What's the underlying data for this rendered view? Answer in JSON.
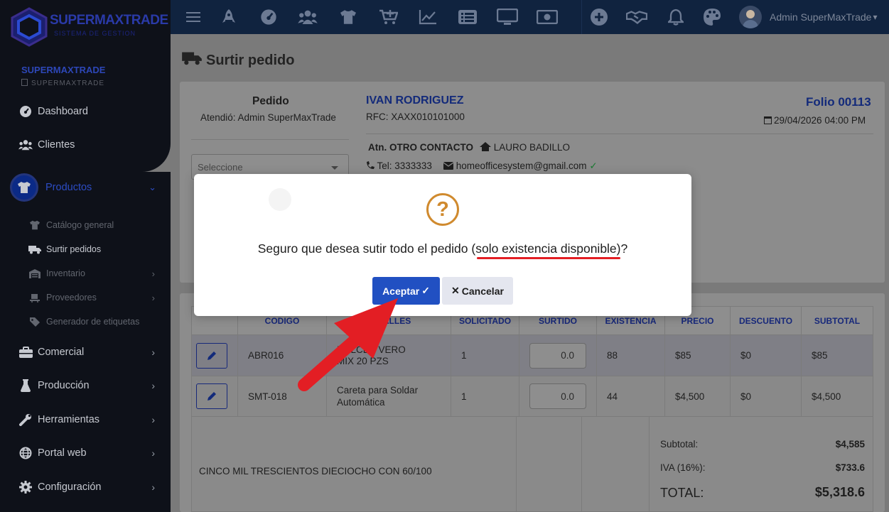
{
  "sidebar": {
    "brand": "SUPERMAXTRADE",
    "brand_sub": "SISTEMA DE GESTION",
    "company_name": "SUPERMAXTRADE",
    "company_sub": "SUPERMAXTRADE",
    "items": {
      "dashboard": "Dashboard",
      "clientes": "Clientes",
      "productos": "Productos",
      "catalogo": "Catálogo general",
      "surtir": "Surtir pedidos",
      "inventario": "Inventario",
      "proveedores": "Proveedores",
      "etiquetas": "Generador de etiquetas",
      "comercial": "Comercial",
      "produccion": "Producción",
      "herramientas": "Herramientas",
      "portal": "Portal web",
      "configuracion": "Configuración"
    },
    "chevron": "›",
    "chevron_down": "⌄"
  },
  "topbar": {
    "icons": [
      "menu-icon",
      "rocket-icon",
      "dashboard-gauge-icon",
      "users-icon",
      "tshirt-icon",
      "cart-plus-icon",
      "line-chart-icon",
      "list-icon",
      "desktop-icon",
      "money-icon",
      "plus-circle-icon",
      "handshake-icon",
      "bell-icon",
      "palette-icon"
    ],
    "user_name": "Admin SuperMaxTrade",
    "caret": "▾"
  },
  "page": {
    "title": "Surtir pedido"
  },
  "order": {
    "label": "Pedido",
    "attended_by": "Atendió: Admin SuperMaxTrade",
    "select_placeholder": "Seleccione",
    "client_name": "IVAN RODRIGUEZ",
    "rfc": "RFC: XAXX010101000",
    "folio": "Folio 00113",
    "date": "29/04/2026 04:00 PM",
    "contact_label": "Atn. OTRO CONTACTO",
    "contact_person": "LAURO BADILLO",
    "phone": "Tel: 3333333",
    "email": "homeofficesystem@gmail.com"
  },
  "table": {
    "headers": [
      "CODIGO",
      "DETALLES",
      "SOLICITADO",
      "SURTIDO",
      "EXISTENCIA",
      "PRECIO",
      "DESCUENTO",
      "SUBTOTAL"
    ],
    "rows": [
      {
        "code": "ABR016",
        "details": "DULCES VERO MIX 20 PZS",
        "details_visible": "DULCES VERO\nMIX 20 PZS",
        "requested": "1",
        "supplied": "0.0",
        "stock": "88",
        "price": "$85",
        "discount": "$0",
        "subtotal": "$85"
      },
      {
        "code": "SMT-018",
        "details": "Careta para Soldar Automática",
        "requested": "1",
        "supplied": "0.0",
        "stock": "44",
        "price": "$4,500",
        "discount": "$0",
        "subtotal": "$4,500"
      }
    ]
  },
  "totals": {
    "amount_words": "CINCO MIL TRESCIENTOS DIECIOCHO CON 60/100",
    "subtotal_label": "Subtotal:",
    "subtotal_value": "$4,585",
    "iva_label": "IVA (16%):",
    "iva_value": "$733.6",
    "total_label": "TOTAL:",
    "total_value": "$5,318.6"
  },
  "modal": {
    "message": "Seguro que desea sutir todo el pedido (solo existencia disponible)?",
    "icon_glyph": "?",
    "accept_label": "Aceptar",
    "accept_glyph": "✓",
    "cancel_glyph": "✕",
    "cancel_label": "Cancelar"
  },
  "colors": {
    "accent": "#2150c2",
    "warning": "#d08a2e",
    "annotation_red": "#e31e24",
    "sidebar_bg": "#0e1119",
    "topbar_bg": "#10233f"
  }
}
